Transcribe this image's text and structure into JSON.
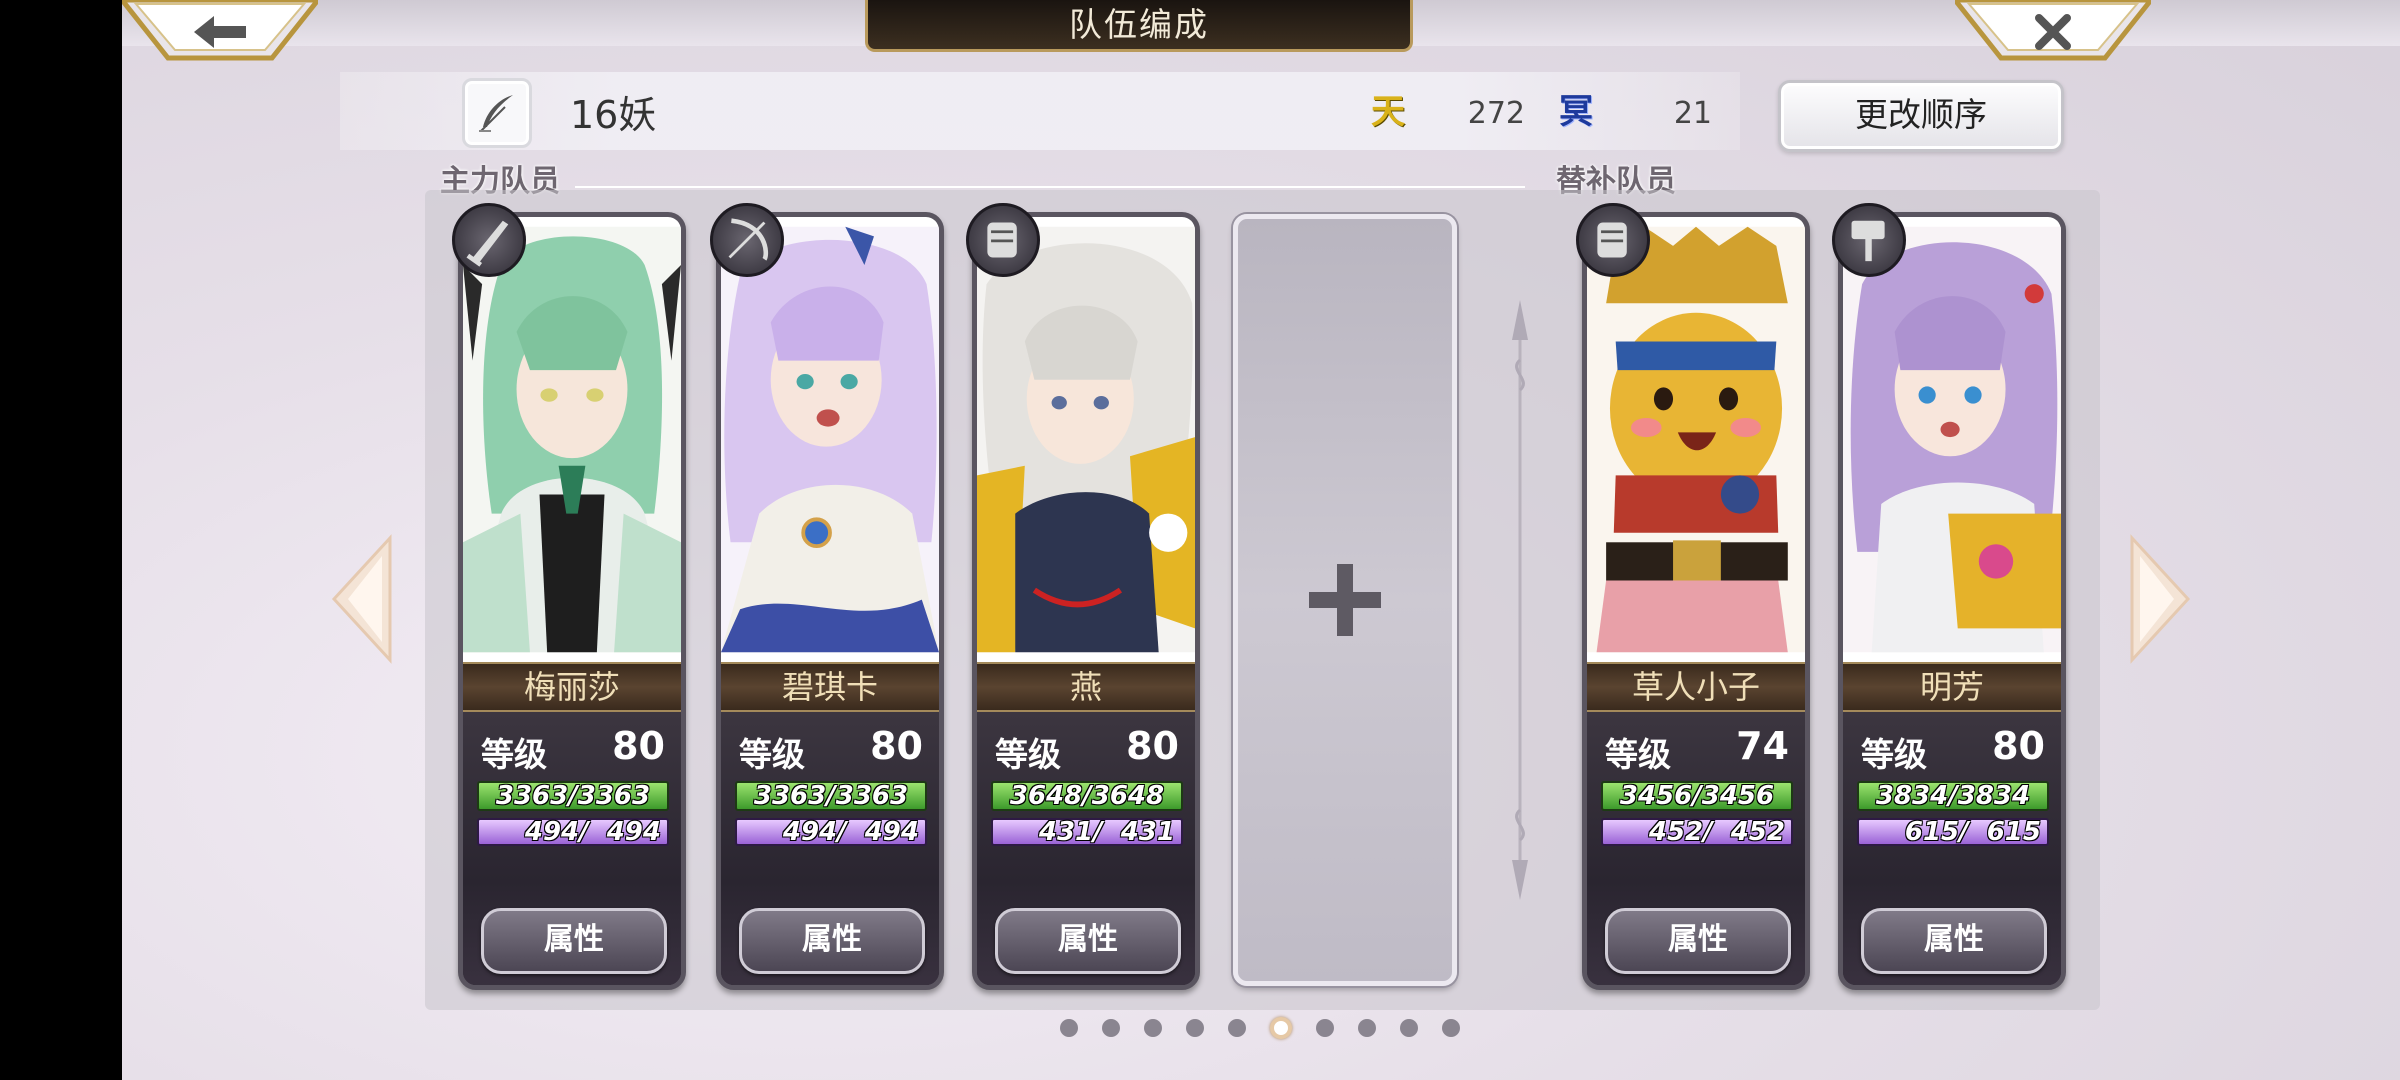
{
  "header": {
    "title": "队伍编成",
    "back_icon": "arrow-left-icon",
    "close_icon": "close-x-icon"
  },
  "team": {
    "name": "16妖",
    "heaven_symbol": "天",
    "heaven_value": "272",
    "underworld_symbol": "冥",
    "underworld_value": "21",
    "reorder_label": "更改顺序",
    "edit_icon": "feather-pen-icon"
  },
  "sections": {
    "main_label": "主力队员",
    "reserve_label": "替补队员"
  },
  "main_members": [
    {
      "name": "梅丽莎",
      "level_label": "等级",
      "level": "80",
      "hp": "3363/3363",
      "mp": " 494/  494",
      "button": "属性",
      "weapon": "greatsword-icon"
    },
    {
      "name": "碧琪卡",
      "level_label": "等级",
      "level": "80",
      "hp": "3363/3363",
      "mp": " 494/  494",
      "button": "属性",
      "weapon": "bow-icon"
    },
    {
      "name": "燕",
      "level_label": "等级",
      "level": "80",
      "hp": "3648/3648",
      "mp": " 431/  431",
      "button": "属性",
      "weapon": "gauntlet-icon"
    }
  ],
  "reserve_members": [
    {
      "name": "草人小子",
      "level_label": "等级",
      "level": "74",
      "hp": "3456/3456",
      "mp": " 452/  452",
      "button": "属性",
      "weapon": "gauntlet-icon"
    },
    {
      "name": "明芳",
      "level_label": "等级",
      "level": "80",
      "hp": "3834/3834",
      "mp": " 615/  615",
      "button": "属性",
      "weapon": "hammer-icon"
    }
  ],
  "empty_slot_icon": "plus-icon",
  "pagination": {
    "total": 10,
    "current": 6
  },
  "colors": {
    "heaven": "#d9b21a",
    "underworld": "#1e3a9c",
    "hp_bar": "#4caf34",
    "mp_bar": "#b37fe6"
  }
}
